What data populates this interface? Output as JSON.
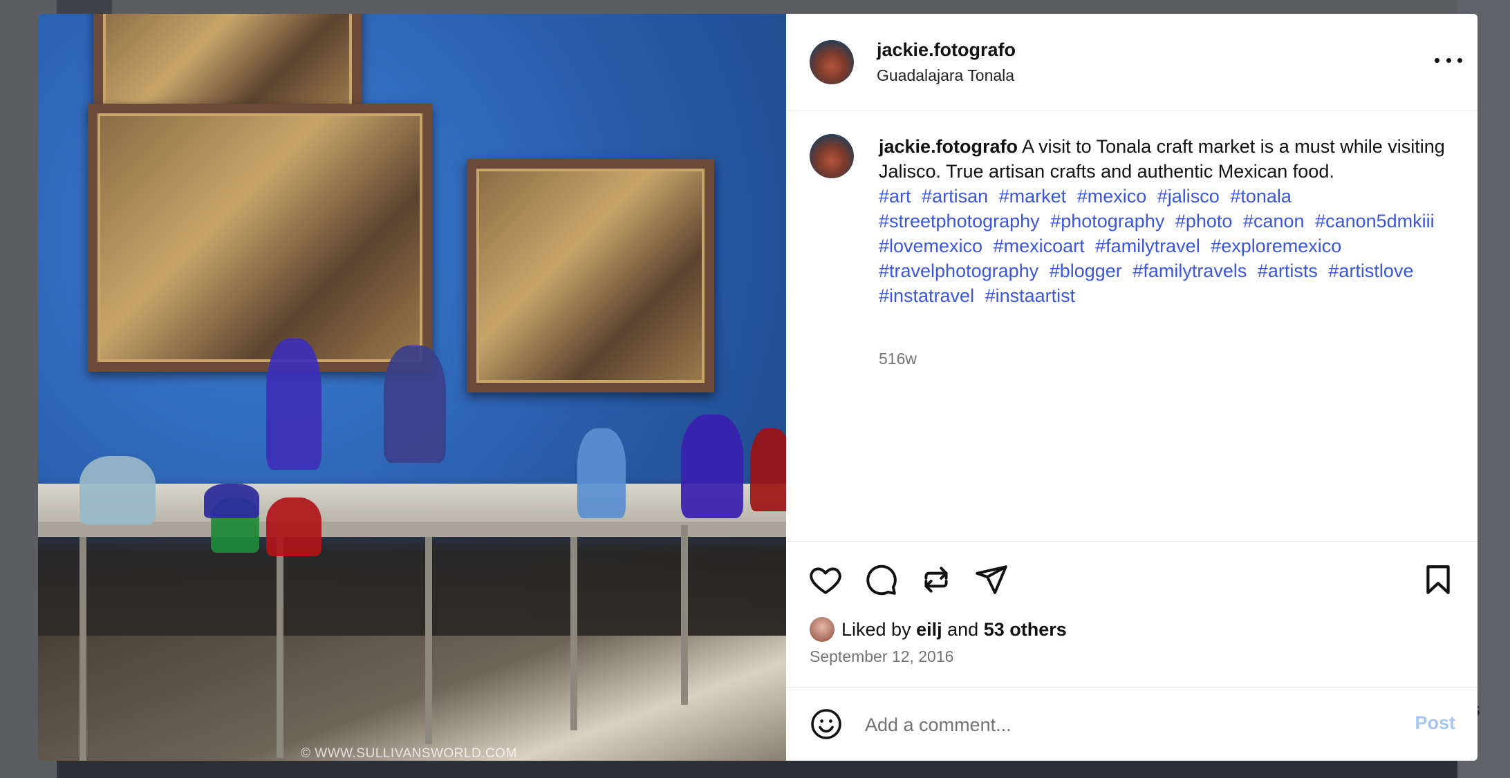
{
  "post": {
    "username": "jackie.fotografo",
    "location": "Guadalajara Tonala",
    "image_watermark": "© WWW.SULLIVANSWORLD.COM"
  },
  "caption": {
    "username": "jackie.fotografo",
    "text": "A visit to Tonala craft market is a must while visiting Jalisco. True artisan crafts and authentic Mexican food.",
    "hashtags": [
      "#art",
      "#artisan",
      "#market",
      "#mexico",
      "#jalisco",
      "#tonala",
      "#streetphotography",
      "#photography",
      "#photo",
      "#canon",
      "#canon5dmkiii",
      "#lovemexico",
      "#mexicoart",
      "#familytravel",
      "#exploremexico",
      "#travelphotography",
      "#blogger",
      "#familytravels",
      "#artists",
      "#artistlove",
      "#instatravel",
      "#instaartist"
    ],
    "time_ago": "516w"
  },
  "likes": {
    "prefix": "Liked by",
    "user": "eilj",
    "joiner": "and",
    "others": "53 others"
  },
  "date": "September 12, 2016",
  "comment": {
    "placeholder": "Add a comment...",
    "post_label": "Post"
  },
  "background": {
    "peek_text": "es"
  },
  "icons": {
    "like": "heart-icon",
    "comment": "speech-bubble-icon",
    "repost": "repost-icon",
    "share": "paper-plane-icon",
    "save": "bookmark-icon",
    "more": "more-options-icon",
    "emoji": "emoji-icon"
  },
  "colors": {
    "hashtag": "#3b56d8",
    "post_button_disabled": "#a7c5f6",
    "muted_text": "#737373"
  }
}
